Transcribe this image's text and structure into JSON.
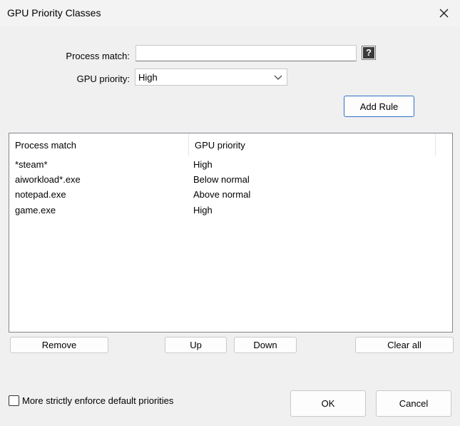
{
  "window": {
    "title": "GPU Priority Classes"
  },
  "form": {
    "process_match_label": "Process match:",
    "process_match_value": "",
    "gpu_priority_label": "GPU priority:",
    "gpu_priority_selected": "High",
    "help_label": "?",
    "add_rule_label": "Add Rule"
  },
  "list": {
    "columns": [
      "Process match",
      "GPU priority"
    ],
    "rows": [
      [
        "*steam*",
        "High"
      ],
      [
        "aiworkload*.exe",
        "Below normal"
      ],
      [
        "notepad.exe",
        "Above normal"
      ],
      [
        "game.exe",
        "High"
      ]
    ]
  },
  "actions": {
    "remove_label": "Remove",
    "up_label": "Up",
    "down_label": "Down",
    "clear_all_label": "Clear all"
  },
  "options": {
    "strict_label": "More strictly enforce default priorities",
    "strict_checked": false
  },
  "footer": {
    "ok_label": "OK",
    "cancel_label": "Cancel"
  }
}
